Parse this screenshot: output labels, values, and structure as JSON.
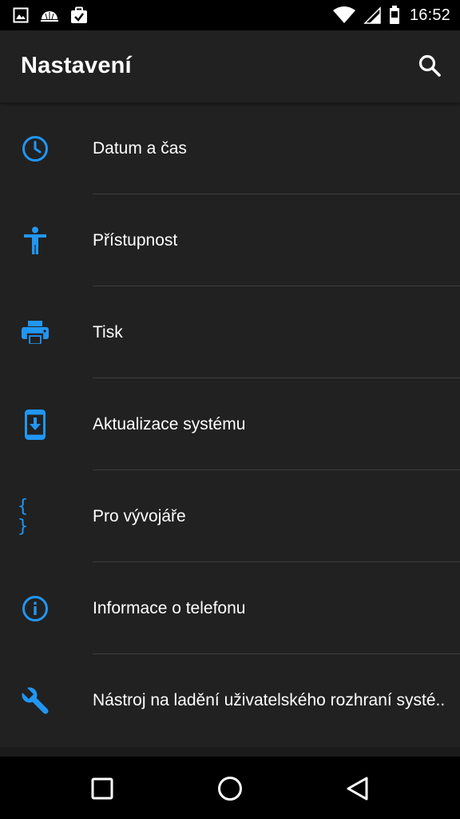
{
  "status_bar": {
    "time": "16:52",
    "left_icons": [
      "image-icon",
      "weather-icon",
      "briefcase-check-icon"
    ],
    "right_icons": [
      "wifi-icon",
      "signal-icon",
      "battery-icon"
    ]
  },
  "app_bar": {
    "title": "Nastavení",
    "search_icon": "search-icon"
  },
  "settings": {
    "items": [
      {
        "label": "Datum a čas",
        "icon": "clock-icon"
      },
      {
        "label": "Přístupnost",
        "icon": "accessibility-icon"
      },
      {
        "label": "Tisk",
        "icon": "printer-icon"
      },
      {
        "label": "Aktualizace systému",
        "icon": "system-update-icon"
      },
      {
        "label": "Pro vývojáře",
        "icon": "developer-braces-icon",
        "glyph": "{ }"
      },
      {
        "label": "Informace o telefonu",
        "icon": "info-icon"
      },
      {
        "label": "Nástroj na ladění uživatelského rozhraní systé..",
        "icon": "wrench-icon"
      }
    ]
  },
  "nav_bar": {
    "buttons": [
      "recents-icon",
      "home-icon",
      "back-icon"
    ]
  },
  "colors": {
    "background": "#212121",
    "accent": "#2196f3",
    "status_bar": "#000000",
    "text": "#ffffff",
    "divider": "#3d3d3d"
  }
}
